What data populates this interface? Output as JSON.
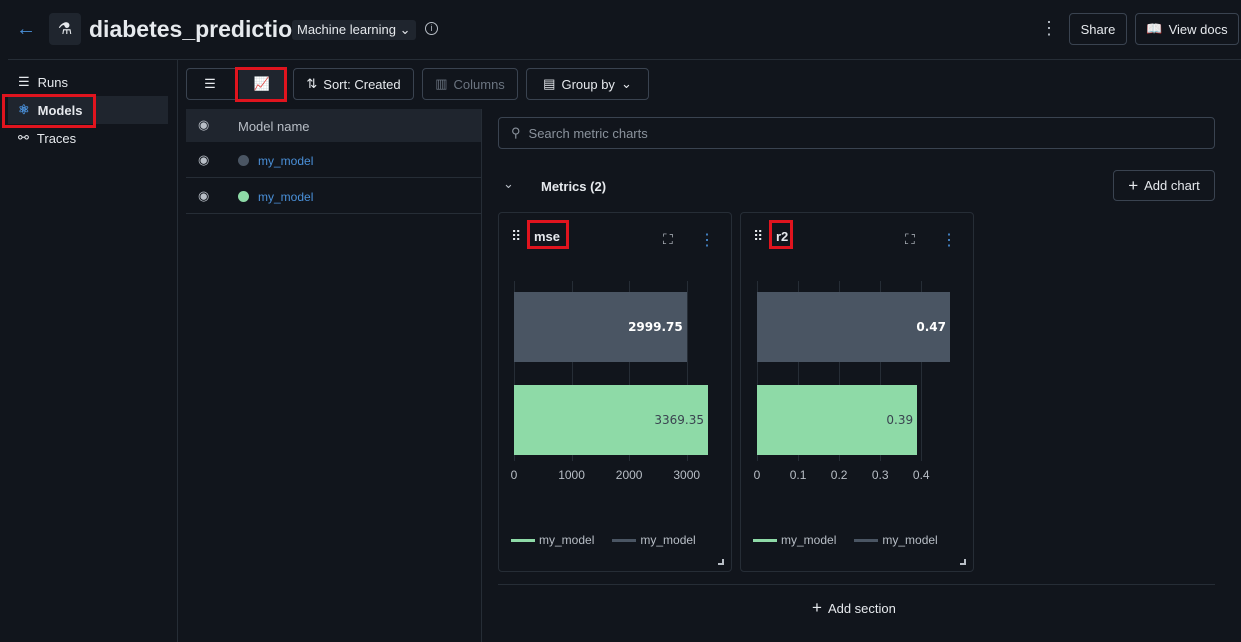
{
  "header": {
    "title": "diabetes_prediction",
    "type_selector": "Machine learning",
    "share": "Share",
    "view_docs": "View docs"
  },
  "sidebar": {
    "items": [
      {
        "label": "Runs"
      },
      {
        "label": "Models"
      },
      {
        "label": "Traces"
      }
    ]
  },
  "toolbar": {
    "sort": "Sort: Created",
    "columns": "Columns",
    "group_by": "Group by"
  },
  "table": {
    "header": "Model name",
    "rows": [
      {
        "name": "my_model",
        "color": "#4a5563"
      },
      {
        "name": "my_model",
        "color": "#8edaa7"
      }
    ]
  },
  "search": {
    "placeholder": "Search metric charts"
  },
  "section": {
    "title": "Metrics (2)",
    "add_chart": "Add chart",
    "add_section": "Add section"
  },
  "chart_data": [
    {
      "type": "bar",
      "title": "mse",
      "categories": [
        "my_model",
        "my_model"
      ],
      "series": [
        {
          "name": "my_model",
          "color": "#4a5563",
          "value": 2999.75,
          "label": "2999.75"
        },
        {
          "name": "my_model",
          "color": "#8edaa7",
          "value": 3369.35,
          "label": "3369.35"
        }
      ],
      "ticks": [
        "0",
        "1000",
        "2000",
        "3000"
      ],
      "tick_values": [
        0,
        1000,
        2000,
        3000
      ],
      "xlim": [
        0,
        3369.35
      ],
      "legend": [
        "my_model",
        "my_model"
      ]
    },
    {
      "type": "bar",
      "title": "r2",
      "categories": [
        "my_model",
        "my_model"
      ],
      "series": [
        {
          "name": "my_model",
          "color": "#4a5563",
          "value": 0.47,
          "label": "0.47"
        },
        {
          "name": "my_model",
          "color": "#8edaa7",
          "value": 0.39,
          "label": "0.39"
        }
      ],
      "ticks": [
        "0",
        "0.1",
        "0.2",
        "0.3",
        "0.4"
      ],
      "tick_values": [
        0,
        0.1,
        0.2,
        0.3,
        0.4
      ],
      "xlim": [
        0,
        0.47
      ],
      "legend": [
        "my_model",
        "my_model"
      ]
    }
  ]
}
